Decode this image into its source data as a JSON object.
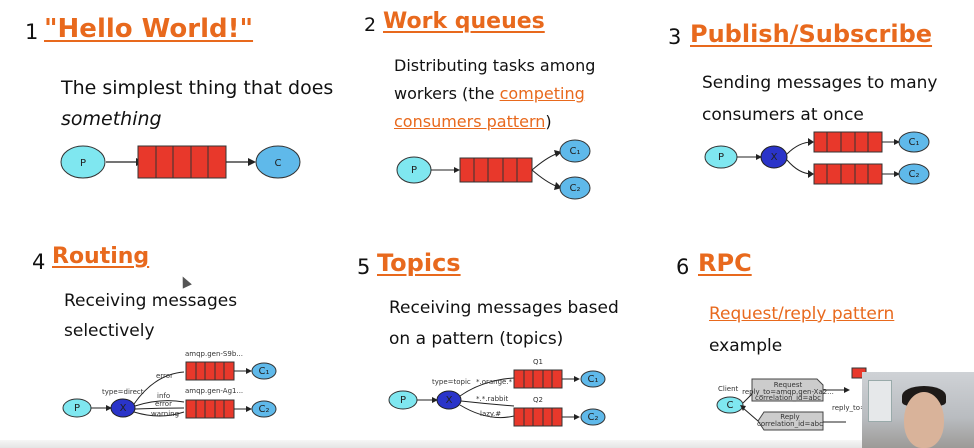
{
  "tiles": [
    {
      "num": "1",
      "title": "\"Hello World!\"",
      "desc1": "The simplest thing that does",
      "desc2": "something"
    },
    {
      "num": "2",
      "title": "Work queues",
      "desc1": "Distributing tasks among",
      "desc2a": "workers (the ",
      "desc2_link": "competing",
      "desc3_link": "consumers pattern",
      "desc3b": ")"
    },
    {
      "num": "3",
      "title": "Publish/Subscribe",
      "desc1": "Sending messages to many",
      "desc2": "consumers at once"
    },
    {
      "num": "4",
      "title": "Routing",
      "desc1": "Receiving messages",
      "desc2": "selectively"
    },
    {
      "num": "5",
      "title": "Topics",
      "desc1": "Receiving messages based",
      "desc2": "on a pattern (topics)"
    },
    {
      "num": "6",
      "title": "RPC",
      "desc1_link": "Request/reply pattern",
      "desc2": "example"
    }
  ],
  "diagram": {
    "producer": "P",
    "consumer": "C",
    "c1": "C₁",
    "c2": "C₂",
    "exchange": "X",
    "routing": {
      "type_label": "type=direct",
      "queue1": "amqp.gen-S9b...",
      "queue2": "amqp.gen-Ag1...",
      "key_error": "error",
      "key_info": "info",
      "key_error2": "error",
      "key_warning": "warning"
    },
    "topics": {
      "type_label": "type=topic",
      "queue1": "Q1",
      "queue2": "Q2",
      "key1": "*.orange.*",
      "key2": "*.*.rabbit",
      "key3": "lazy.#"
    },
    "rpc": {
      "client": "Client",
      "request": "Request",
      "request_detail1": "reply_to=amqp.gen-Xa2...",
      "request_detail2": "correlation_id=abc",
      "reply": "Reply",
      "reply_detail": "correlation_id=abc",
      "reply_to": "reply_to=..."
    }
  },
  "colors": {
    "accent": "#e8691d",
    "producer_fill": "#7fe7f0",
    "consumer_fill": "#5fb9ea",
    "queue_fill": "#e8382b",
    "exchange_fill": "#2a34c9"
  }
}
